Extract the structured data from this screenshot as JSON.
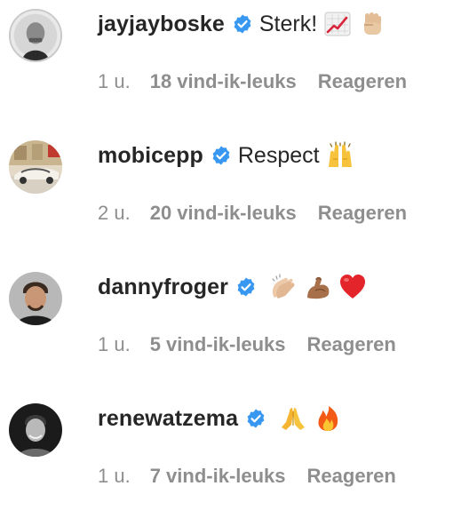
{
  "comments": [
    {
      "username": "jayjayboske",
      "verified": true,
      "text": "Sterk!",
      "emojis": [
        "chart-increasing-emoji",
        "raised-fist-emoji"
      ],
      "time": "1 u.",
      "likes": "18 vind-ik-leuks",
      "reply": "Reageren"
    },
    {
      "username": "mobicepp",
      "verified": true,
      "text": "Respect",
      "emojis": [
        "raising-hands-emoji"
      ],
      "time": "2 u.",
      "likes": "20 vind-ik-leuks",
      "reply": "Reageren"
    },
    {
      "username": "dannyfroger",
      "verified": true,
      "text": "",
      "emojis": [
        "clapping-hands-emoji",
        "flexed-biceps-emoji",
        "red-heart-emoji"
      ],
      "time": "1 u.",
      "likes": "5 vind-ik-leuks",
      "reply": "Reageren"
    },
    {
      "username": "renewatzema",
      "verified": true,
      "text": "",
      "emojis": [
        "folded-hands-emoji",
        "fire-emoji"
      ],
      "time": "1 u.",
      "likes": "7 vind-ik-leuks",
      "reply": "Reageren"
    }
  ],
  "colors": {
    "text": "#262626",
    "secondary": "#8e8e8e",
    "verified": "#3897f0"
  }
}
